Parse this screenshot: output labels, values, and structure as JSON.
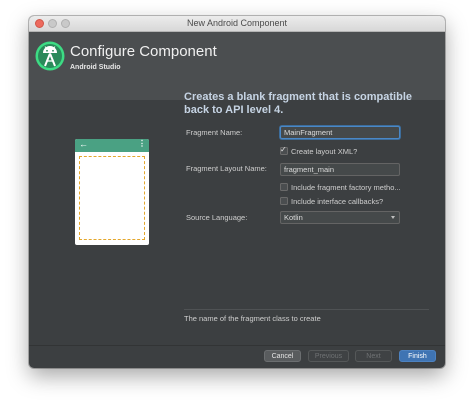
{
  "window": {
    "title": "New Android Component"
  },
  "header": {
    "title": "Configure Component",
    "subtitle": "Android Studio",
    "logo_icon": "android-studio-logo"
  },
  "description": "Creates a blank fragment that is compatible back to API level 4.",
  "form": {
    "fragment_name": {
      "label": "Fragment Name:",
      "value": "MainFragment"
    },
    "create_layout_xml": {
      "label": "Create layout XML?",
      "checked": true
    },
    "fragment_layout_name": {
      "label": "Fragment Layout Name:",
      "value": "fragment_main"
    },
    "include_factory_methods": {
      "label": "Include fragment factory metho...",
      "checked": false
    },
    "include_interface_callbacks": {
      "label": "Include interface callbacks?",
      "checked": false
    },
    "source_language": {
      "label": "Source Language:",
      "value": "Kotlin"
    }
  },
  "preview": {
    "back_icon": "arrow-left-icon",
    "menu_icon": "overflow-menu-icon",
    "accent": "#4aa183",
    "fragment_border": "#e4a72c"
  },
  "hint": "The name of the fragment class to create",
  "buttons": {
    "cancel": "Cancel",
    "previous": "Previous",
    "next": "Next",
    "finish": "Finish"
  },
  "colors": {
    "background": "#3c3f41",
    "header": "#4b4e50",
    "primary": "#3f74b3",
    "description": "#c6d4e4"
  }
}
